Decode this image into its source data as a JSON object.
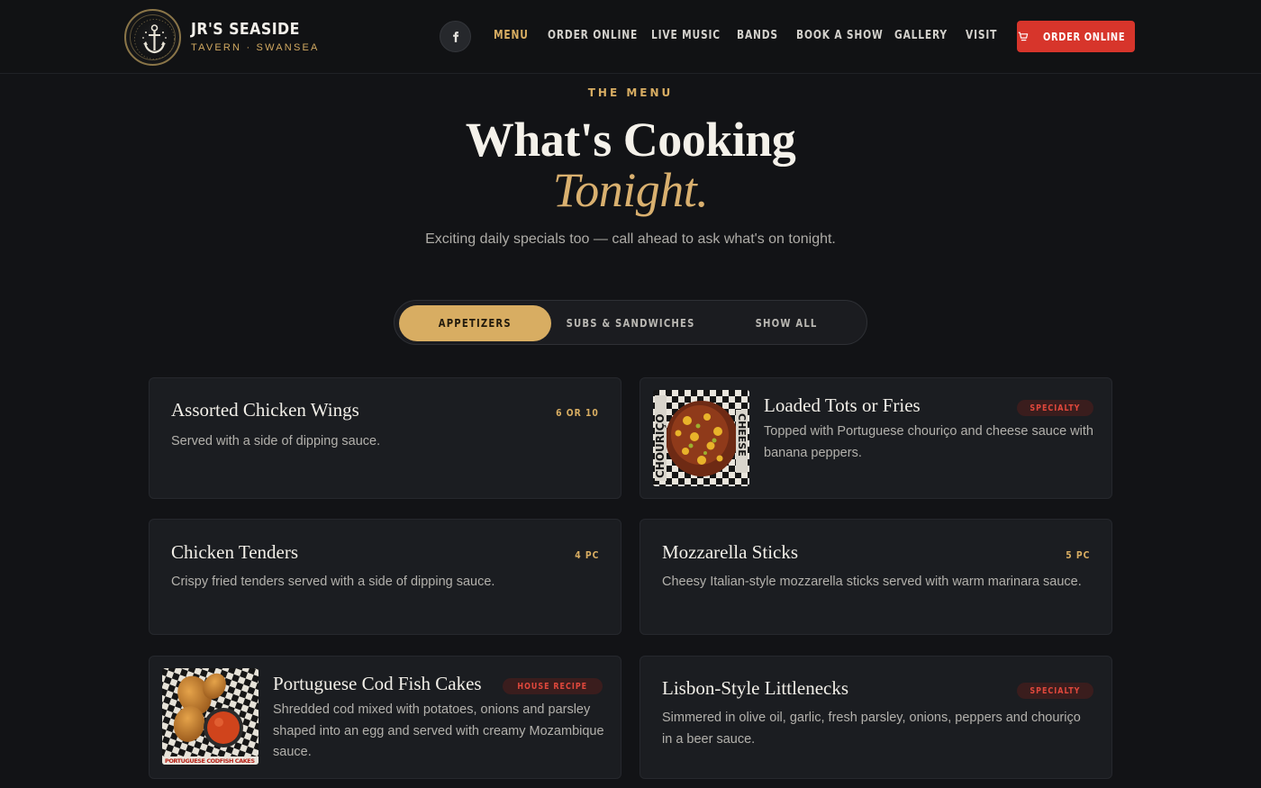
{
  "header": {
    "brand_name": "JR'S SEASIDE",
    "brand_sub": "TAVERN · SWANSEA",
    "logo_icon": "anchor-seal-logo",
    "facebook_icon": "facebook-icon",
    "nav": [
      {
        "label": "MENU",
        "active": true
      },
      {
        "label": "ORDER ONLINE",
        "active": false
      },
      {
        "label": "LIVE MUSIC",
        "active": false
      },
      {
        "label": "BANDS",
        "active": false
      },
      {
        "label": "BOOK A SHOW",
        "active": false
      },
      {
        "label": "GALLERY",
        "active": false
      },
      {
        "label": "VISIT",
        "active": false
      }
    ],
    "order_button": {
      "label": "ORDER ONLINE",
      "icon": "cart-icon"
    }
  },
  "hero": {
    "eyebrow": "THE MENU",
    "title_line1": "What's Cooking",
    "title_line2": "Tonight.",
    "tagline": "Exciting daily specials too — call ahead to ask what's on tonight."
  },
  "tabs": [
    {
      "label": "APPETIZERS",
      "active": true
    },
    {
      "label": "SUBS & SANDWICHES",
      "active": false
    },
    {
      "label": "SHOW ALL",
      "active": false
    }
  ],
  "menu_items": [
    {
      "title": "Assorted Chicken Wings",
      "qty": "6 OR 10",
      "badge": "",
      "desc": "Served with a side of dipping sauce."
    },
    {
      "title": "Loaded Tots or Fries",
      "qty": "",
      "badge": "SPECIALTY",
      "desc": "Topped with Portuguese chouriço and cheese sauce with banana peppers.",
      "image_text": [
        "CHOURIÇO",
        "CHEESE"
      ]
    },
    {
      "title": "Chicken Tenders",
      "qty": "4 PC",
      "badge": "",
      "desc": "Crispy fried tenders served with a side of dipping sauce."
    },
    {
      "title": "Mozzarella Sticks",
      "qty": "5 PC",
      "badge": "",
      "desc": "Cheesy Italian-style mozzarella sticks served with warm marinara sauce."
    },
    {
      "title": "Portuguese Cod Fish Cakes",
      "qty": "",
      "badge": "HOUSE RECIPE",
      "desc": "Shredded cod mixed with potatoes, onions and parsley shaped into an egg and served with creamy Mozambique sauce.",
      "image_text": [
        "PORTUGUESE CODFISH CAKES"
      ]
    },
    {
      "title": "Lisbon-Style Littlenecks",
      "qty": "",
      "badge": "SPECIALTY",
      "desc": "Simmered in olive oil, garlic, fresh parsley, onions, peppers and chouriço in a beer sauce."
    }
  ],
  "colors": {
    "background": "#121316",
    "accent_gold": "#d8ad62",
    "order_red": "#d7352b",
    "badge_red": "#e0483c",
    "card": "#1b1d21"
  }
}
